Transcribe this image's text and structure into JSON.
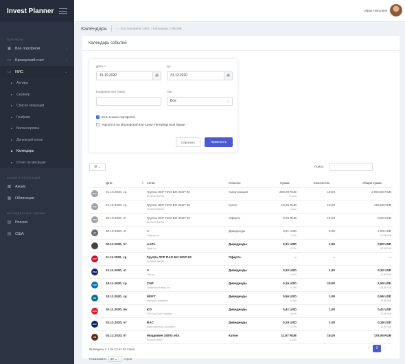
{
  "app": {
    "title": "Invest Planner"
  },
  "user": {
    "name": "Ифан Николаев"
  },
  "sidebar": {
    "sections": [
      "ПОРТФЕЛИ",
      "АКЦИИ И ОБЛИГАЦИИ",
      "ИНСАЙДЕРСКИЕ СДЕЛКИ"
    ],
    "items": [
      {
        "label": "Все портфели"
      },
      {
        "label": "Брокерский счет"
      },
      {
        "label": "ИИС"
      },
      {
        "label": "Акции"
      },
      {
        "label": "Облигации"
      },
      {
        "label": "Россия"
      },
      {
        "label": "США"
      }
    ],
    "submenu": [
      {
        "label": "Активы"
      },
      {
        "label": "Скринер"
      },
      {
        "label": "Список операций"
      },
      {
        "label": "Графики"
      },
      {
        "label": "Балансировка"
      },
      {
        "label": "Денежный поток"
      },
      {
        "label": "Календарь"
      },
      {
        "label": "Отчет по месяцам"
      }
    ]
  },
  "breadcrumb": {
    "title": "Календарь",
    "trail": "⌂ › Все портфели › ИИС › Календарь событий"
  },
  "card": {
    "title": "Календарь событий"
  },
  "filter": {
    "date_from_label": "Дата с:",
    "date_from": "15.10.2020",
    "date_to_label": "до:",
    "date_to": "31.12.2020",
    "ticker_label": "Название или тикер:",
    "ticker_value": "",
    "type_label": "Тип:",
    "type_value": "Все",
    "check1": "Есть в моих портфелях",
    "check2": "Торгуется на Московской или Санкт-Петербургской бирже",
    "reset": "Сбросить",
    "apply": "Применить"
  },
  "search": {
    "label": "Поиск:"
  },
  "table": {
    "headers": [
      "Дата",
      "Актив",
      "Событие",
      "Сумма",
      "Количество",
      "Общая сумма"
    ],
    "rows": [
      {
        "date": "21.10.2020, ср",
        "asset": "Группа ЛСР ПАО БО 001Р-02",
        "isin": "RU000A0JWPM8",
        "event": "Амортизация",
        "sum": "200,00 RUB",
        "pct": "20,00%",
        "qty": "10,00",
        "total": "2 000,00 RUB",
        "bold": false,
        "logo": "ЛСР",
        "color": "#9a9ea6"
      },
      {
        "date": "21.10.2020, ср",
        "asset": "Группа ЛСР ПАО БО 001Р-02",
        "isin": "RU000A0JWPM8",
        "event": "Купон",
        "sum": "19,25 RUB",
        "pct": "9,65%",
        "qty": "10,00",
        "total": "192,50 RUB",
        "bold": false,
        "logo": "ЛСР",
        "color": "#9a9ea6"
      },
      {
        "date": "30.10.2020, пт",
        "asset": "Группа ЛСР ПАО БО 001Р-02",
        "isin": "RU000A0JWPM8",
        "event": "Оферта",
        "sum": "0,00 RUB",
        "pct": "",
        "qty": "10,00",
        "total": "0,00 RUB",
        "bold": false,
        "logo": "ЛСР",
        "color": "#9a9ea6"
      },
      {
        "date": "30.10.2020, пт",
        "asset": "C",
        "isin": "Citigroup Inc.",
        "event": "Дивиденды",
        "sum": "0,51 USD",
        "pct": "1,12%",
        "qty": "3,00",
        "total": "1,53 USD",
        "total2": "114,28 RUB",
        "bold": false,
        "logo": "citi",
        "color": "#6b7078"
      },
      {
        "date": "06.11.2020, пт",
        "asset": "AAPL",
        "isin": "Apple Inc.",
        "event": "Дивиденды",
        "sum": "0,21 USD",
        "pct": "0,19%",
        "qty": "4,00",
        "total": "0,82 USD",
        "total2": "63,95 RUB",
        "bold": true,
        "logo": "",
        "color": "#444444"
      },
      {
        "date": "11.11.2020, ср",
        "asset": "Группа ЛСР ПАО БО 001Р-02",
        "isin": "RU000A0JWPM8",
        "event": "Оферта",
        "sum": "–",
        "pct": "",
        "qty": "–",
        "total": "–",
        "bold": true,
        "logo": "ЛСР",
        "color": "#c8102e"
      },
      {
        "date": "12.11.2020, чт",
        "asset": "V",
        "isin": "Visa Inc.",
        "event": "Дивиденды",
        "sum": "0,32 USD",
        "pct": "0,16%",
        "qty": "1,00",
        "total": "0,32 USD",
        "total2": "24,93 RUB",
        "bold": true,
        "logo": "VISA",
        "color": "#1a1f71"
      },
      {
        "date": "18.11.2020, ср",
        "asset": "CNP",
        "isin": "CenterPoint Energy, Inc.",
        "event": "Дивиденды",
        "sum": "0,15 USD",
        "pct": "0,70%",
        "qty": "10,00",
        "total": "1,50 USD",
        "total2": "116,94 RUB",
        "bold": true,
        "logo": "CNP",
        "color": "#0072bc"
      },
      {
        "date": "18.11.2020, ср",
        "asset": "MSFT",
        "isin": "Microsoft Corporation",
        "event": "Дивиденды",
        "sum": "0,56 USD",
        "pct": "0,26%",
        "qty": "1,00",
        "total": "0,56 USD",
        "total2": "43,66 RUB",
        "bold": true,
        "logo": "MS",
        "color": "#0f6f8f"
      },
      {
        "date": "30.11.2020, пн",
        "asset": "KO",
        "isin": "The Coca-Cola Company",
        "event": "Дивиденды",
        "sum": "0,41 USD",
        "pct": "0,81%",
        "qty": "1,00",
        "total": "0,41 USD",
        "total2": "31,96 RUB",
        "bold": true,
        "logo": "Coke",
        "color": "#e41e2b"
      },
      {
        "date": "03.12.2020, чт",
        "asset": "BAC",
        "isin": "Bank of America Corporation",
        "event": "Дивиденды",
        "sum": "0,18 USD",
        "pct": "0,75%",
        "qty": "1,00",
        "total": "0,18 USD",
        "total2": "14,03 RUB",
        "bold": true,
        "logo": "BAC",
        "color": "#012169"
      },
      {
        "date": "04.12.2020, пт",
        "asset": "Мордовия 34003 обл.",
        "isin": "RU000A0JWB27",
        "event": "Купон",
        "sum": "11,67 RUB",
        "pct": "11,70%",
        "qty": "15,00",
        "total": "175,05 RUB",
        "bold": true,
        "logo": "РМ",
        "color": "#5a2d1a"
      }
    ]
  },
  "footer": {
    "info": "Выведены с 1 по 12 из 12 строк",
    "perpage_prefix": "Показывать",
    "perpage_value": "50",
    "perpage_suffix": "строк",
    "page": "1"
  }
}
